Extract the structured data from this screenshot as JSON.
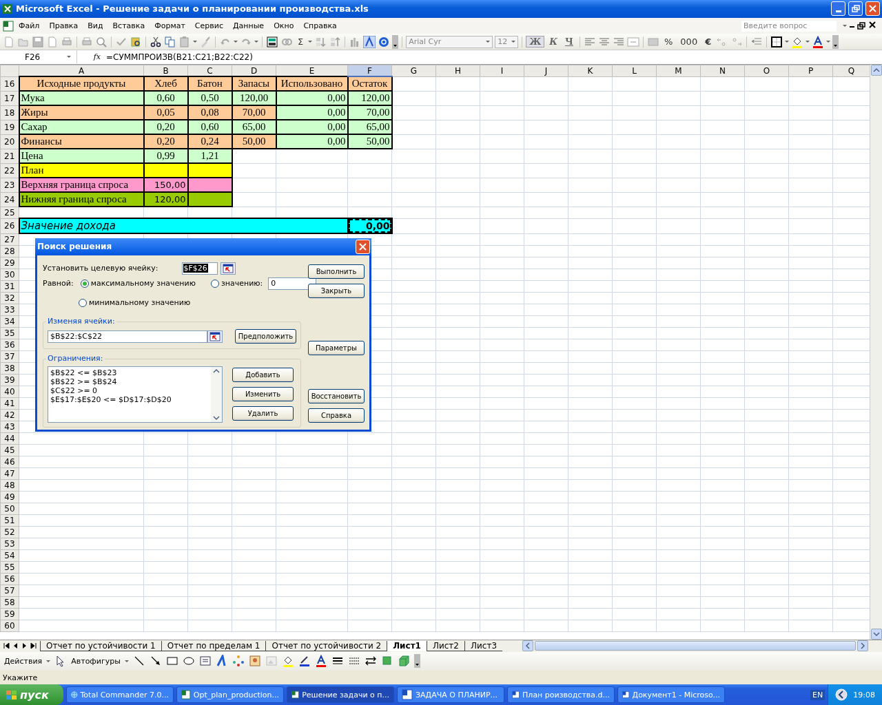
{
  "window": {
    "title": "Microsoft Excel - Решение задачи о планировании производства.xls"
  },
  "menu": [
    "Файл",
    "Правка",
    "Вид",
    "Вставка",
    "Формат",
    "Сервис",
    "Данные",
    "Окно",
    "Справка"
  ],
  "help_search": {
    "placeholder": "Введите вопрос"
  },
  "toolbar": {
    "sum": "Σ",
    "font": "Arial Cyr",
    "size": "12",
    "bold": "Ж",
    "italic": "К",
    "underline": "Ч",
    "percent": "%",
    "thousands": "000",
    "euro": "€"
  },
  "formula_bar": {
    "name_box": "F26",
    "fx": "fx",
    "formula": "=СУММПРОИЗВ(B21:C21;B22:C22)"
  },
  "columns": [
    {
      "label": "A",
      "selected": false
    },
    {
      "label": "B",
      "selected": false
    },
    {
      "label": "C",
      "selected": false
    },
    {
      "label": "D",
      "selected": false
    },
    {
      "label": "E",
      "selected": false
    },
    {
      "label": "F",
      "selected": true
    },
    {
      "label": "G",
      "selected": false
    },
    {
      "label": "H",
      "selected": false
    },
    {
      "label": "I",
      "selected": false
    },
    {
      "label": "J",
      "selected": false
    },
    {
      "label": "K",
      "selected": false
    },
    {
      "label": "L",
      "selected": false
    },
    {
      "label": "M",
      "selected": false
    },
    {
      "label": "N",
      "selected": false
    },
    {
      "label": "O",
      "selected": false
    },
    {
      "label": "P",
      "selected": false
    },
    {
      "label": "Q",
      "selected": false
    }
  ],
  "rows": [
    {
      "number": "16",
      "cells": [
        {
          "kind": "header",
          "text": "Исходные продукты",
          "color": "#ffcc99"
        },
        {
          "kind": "header",
          "text": "Хлеб",
          "color": "#ffcc99"
        },
        {
          "kind": "header",
          "text": "Батон",
          "color": "#ffcc99"
        },
        {
          "kind": "header",
          "text": "Запасы",
          "color": "#ffcc99"
        },
        {
          "kind": "header",
          "text": "Использовано",
          "color": "#ffcc99"
        },
        {
          "kind": "header",
          "text": "Остаток",
          "color": "#ffcc99"
        }
      ]
    },
    {
      "number": "17",
      "cells": [
        {
          "kind": "label",
          "text": "Мука",
          "color": "#ccffcc"
        },
        {
          "kind": "value",
          "text": "0,60",
          "color": "#ccffcc"
        },
        {
          "kind": "value",
          "text": "0,50",
          "color": "#ccffcc"
        },
        {
          "kind": "value",
          "text": "120,00",
          "color": "#ccffcc"
        },
        {
          "kind": "amount",
          "text": "0,00",
          "color": "#ccffcc"
        },
        {
          "kind": "amount",
          "text": "120,00",
          "color": "#ccffcc"
        }
      ]
    },
    {
      "number": "18",
      "cells": [
        {
          "kind": "label",
          "text": "Жиры",
          "color": "#ffcc99"
        },
        {
          "kind": "value",
          "text": "0,05",
          "color": "#ffcc99"
        },
        {
          "kind": "value",
          "text": "0,08",
          "color": "#ffcc99"
        },
        {
          "kind": "value",
          "text": "70,00",
          "color": "#ffcc99"
        },
        {
          "kind": "amount",
          "text": "0,00",
          "color": "#ccffcc"
        },
        {
          "kind": "amount",
          "text": "70,00",
          "color": "#ccffcc"
        }
      ]
    },
    {
      "number": "19",
      "cells": [
        {
          "kind": "label",
          "text": "Сахар",
          "color": "#ccffcc"
        },
        {
          "kind": "value",
          "text": "0,20",
          "color": "#ccffcc"
        },
        {
          "kind": "value",
          "text": "0,60",
          "color": "#ccffcc"
        },
        {
          "kind": "value",
          "text": "65,00",
          "color": "#ccffcc"
        },
        {
          "kind": "amount",
          "text": "0,00",
          "color": "#ccffcc"
        },
        {
          "kind": "amount",
          "text": "65,00",
          "color": "#ccffcc"
        }
      ]
    },
    {
      "number": "20",
      "cells": [
        {
          "kind": "label",
          "text": "Финансы",
          "color": "#ffcc99"
        },
        {
          "kind": "value",
          "text": "0,20",
          "color": "#ffcc99"
        },
        {
          "kind": "value",
          "text": "0,24",
          "color": "#ffcc99"
        },
        {
          "kind": "value",
          "text": "50,00",
          "color": "#ffcc99"
        },
        {
          "kind": "amount",
          "text": "0,00",
          "color": "#ccffcc"
        },
        {
          "kind": "amount",
          "text": "50,00",
          "color": "#ccffcc"
        }
      ]
    },
    {
      "number": "21",
      "cells": [
        {
          "kind": "label",
          "text": "Цена",
          "color": "#ccffcc"
        },
        {
          "kind": "value",
          "text": "0,99",
          "color": "#ccffcc"
        },
        {
          "kind": "value",
          "text": "1,21",
          "color": "#ccffcc"
        }
      ]
    },
    {
      "number": "22",
      "cells": [
        {
          "kind": "label",
          "text": "План",
          "color": "#ffff00"
        },
        {
          "kind": "value",
          "color": "#ffff00"
        },
        {
          "kind": "value",
          "color": "#ffff00"
        }
      ]
    },
    {
      "number": "23",
      "cells": [
        {
          "kind": "label",
          "text": "Верхняя граница спроса",
          "color": "#ff99cc"
        },
        {
          "kind": "amount",
          "text": "150,00",
          "color": "#ff99cc"
        },
        {
          "kind": "value",
          "color": "#ff99cc"
        }
      ]
    },
    {
      "number": "24",
      "cells": [
        {
          "kind": "label",
          "text": "Нижняя граница спроса",
          "color": "#99cc00"
        },
        {
          "kind": "amount",
          "text": "120,00",
          "color": "#99cc00"
        },
        {
          "kind": "value",
          "color": "#99cc00"
        }
      ]
    },
    {
      "number": "25"
    },
    {
      "number": "26",
      "cells": [
        {
          "kind": "merged",
          "text": "Значение дохода",
          "color": "#00ffff",
          "italic": true
        },
        {
          "kind": "amount",
          "text": "0,00",
          "color": "#00ffff",
          "bold": true,
          "selected": true
        }
      ]
    },
    {
      "number": "27"
    },
    {
      "number": "28"
    },
    {
      "number": "29"
    },
    {
      "number": "30"
    },
    {
      "number": "31"
    },
    {
      "number": "32"
    },
    {
      "number": "33"
    },
    {
      "number": "34"
    },
    {
      "number": "35"
    },
    {
      "number": "36"
    },
    {
      "number": "37"
    },
    {
      "number": "38"
    },
    {
      "number": "39"
    },
    {
      "number": "40"
    },
    {
      "number": "41"
    },
    {
      "number": "42"
    },
    {
      "number": "43"
    },
    {
      "number": "44"
    },
    {
      "number": "45"
    },
    {
      "number": "46"
    },
    {
      "number": "47"
    },
    {
      "number": "48"
    },
    {
      "number": "49"
    },
    {
      "number": "50"
    },
    {
      "number": "51"
    },
    {
      "number": "52"
    },
    {
      "number": "53"
    },
    {
      "number": "54"
    },
    {
      "number": "55"
    },
    {
      "number": "56"
    },
    {
      "number": "57"
    },
    {
      "number": "58"
    },
    {
      "number": "59"
    },
    {
      "number": "60"
    }
  ],
  "dialog": {
    "title": "Поиск решения",
    "target_label": "Установить целевую ячейку:",
    "target": "$F$26",
    "equal_label": "Равной:",
    "options": [
      {
        "label": "максимальному значению",
        "selected": true
      },
      {
        "label": "значению:",
        "selected": false
      },
      {
        "label": "минимальному значению",
        "selected": false
      }
    ],
    "value": "0",
    "changing_label": "Изменяя ячейки:",
    "changing": "$B$22:$C$22",
    "guess_button": "Предположить",
    "constraints_label": "Ограничения:",
    "constraints": [
      "$B$22 <= $B$23",
      "$B$22 >= $B$24",
      "$C$22 >= 0",
      "$E$17:$E$20 <= $D$17:$D$20"
    ],
    "constraint_buttons": [
      "Добавить",
      "Изменить",
      "Удалить"
    ],
    "buttons": [
      "Выполнить",
      "Закрыть",
      "Параметры",
      "Восстановить",
      "Справка"
    ]
  },
  "sheet_tabs": [
    {
      "label": "Отчет по устойчивости 1",
      "selected": false
    },
    {
      "label": "Отчет по пределам 1",
      "selected": false
    },
    {
      "label": "Отчет по устойчивости 2",
      "selected": false
    },
    {
      "label": "Лист1",
      "selected": true
    },
    {
      "label": "Лист2",
      "selected": false
    },
    {
      "label": "Лист3",
      "selected": false
    }
  ],
  "drawing_toolbar": {
    "actions": "Действия",
    "autoshapes": "Автофигуры"
  },
  "status_bar": "Укажите",
  "taskbar": {
    "start": "пуск",
    "tasks": [
      {
        "label": "Total Commander 7.0...",
        "selected": false
      },
      {
        "label": "Opt_plan_production...",
        "selected": false
      },
      {
        "label": "Решение задачи о п...",
        "selected": true
      },
      {
        "label": "ЗАДАЧА О ПЛАНИР...",
        "selected": false
      },
      {
        "label": "План роизводства.d...",
        "selected": false
      },
      {
        "label": "Документ1 - Microso...",
        "selected": false
      }
    ],
    "language": "EN",
    "clock": "19:08"
  }
}
